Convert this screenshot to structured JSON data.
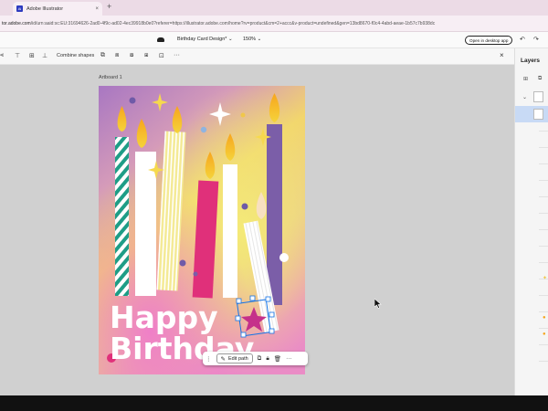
{
  "browser": {
    "tab_title": "Adobe Illustrator",
    "tab_icon": "Ai",
    "tab_close": "×",
    "new_tab": "+",
    "url_host": "tor.adobe.com",
    "url_path": "/id/urn:aaid:sc:EU:31694626-2ad0-4f9c-ad02-4ec39918b0e0?referer=https://illustrator.adobe.com/home?rv=product&cm=2+accc&v-product=undefined&gen=13bd8670-f0c4-4abd-aeae-1b57c7b938dc"
  },
  "header": {
    "doc_title": "Birthday Card Design*",
    "zoom": "150%",
    "open_desktop_label": "Open in desktop app",
    "undo_glyph": "↶",
    "redo_glyph": "↷"
  },
  "context_toolbar": {
    "combine_label": "Combine shapes",
    "close_glyph": "×",
    "more_glyph": "···"
  },
  "canvas": {
    "artboard_label": "Artboard 1",
    "card_line1": "Happy",
    "card_line2": "Birthday"
  },
  "floating_toolbar": {
    "edit_path_label": "Edit path",
    "more_glyph": "···"
  },
  "layers_panel": {
    "title": "Layers"
  },
  "colors": {
    "accent": "#1473e6",
    "card_purple": "#b87fc6",
    "card_yellow": "#e9e07a",
    "card_pink": "#e98bc4",
    "teal": "#1e9d86",
    "magenta": "#e0307a",
    "violet": "#7b5ea8"
  }
}
